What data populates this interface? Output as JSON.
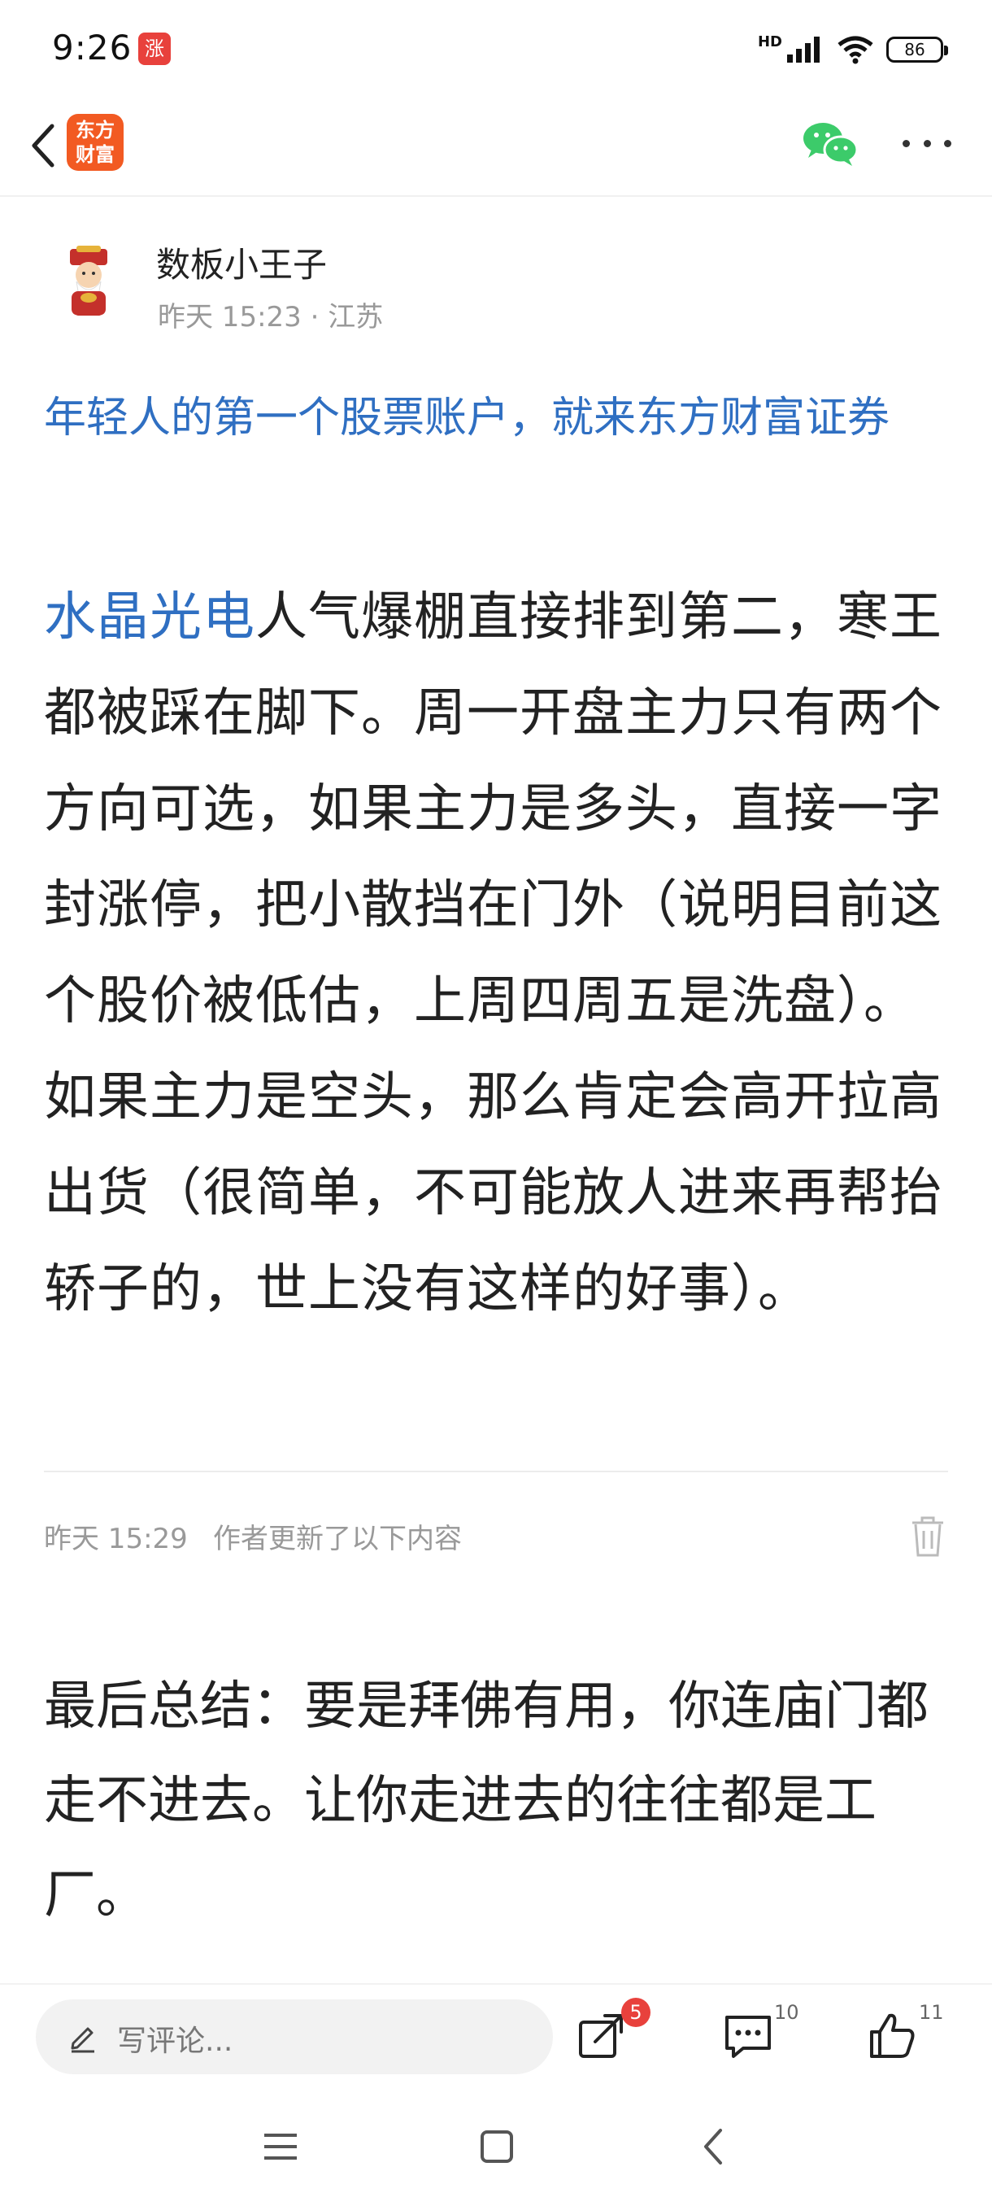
{
  "status_bar": {
    "time": "9:26",
    "notif_app_glyph": "涨",
    "network_label": "HD",
    "battery": "86"
  },
  "nav": {
    "logo_line1": "东方",
    "logo_line2": "财富"
  },
  "author": {
    "name": "数板小王子",
    "meta": "昨天 15:23 · 江苏"
  },
  "ad_text": "年轻人的第一个股票账户，就来东方财富证券",
  "post": {
    "stock_link": "水晶光电",
    "body": "人气爆棚直接排到第二，寒王都被踩在脚下。周一开盘主力只有两个方向可选，如果主力是多头，直接一字封涨停，把小散挡在门外（说明目前这个股价被低估，上周四周五是洗盘）。如果主力是空头，那么肯定会高开拉高出货（很简单，不可能放人进来再帮抬轿子的，世上没有这样的好事）。"
  },
  "update": {
    "time": "昨天 15:29",
    "label": "作者更新了以下内容"
  },
  "summary": "最后总结：要是拜佛有用，你连庙门都走不进去。让你走进去的往往都是工厂。",
  "bottom_bar": {
    "comment_placeholder": "写评论...",
    "share_badge": "5",
    "comment_count": "10",
    "like_count": "11"
  },
  "colors": {
    "link": "#2f6fc2",
    "brand": "#f25a22",
    "badge": "#e8413c",
    "wechat": "#3ccb6a"
  },
  "icons": [
    "back-icon",
    "wechat-icon",
    "more-icon",
    "trash-icon",
    "pen-icon",
    "share-icon",
    "comment-icon",
    "like-icon",
    "menu-icon",
    "home-icon",
    "nav-back-icon"
  ]
}
